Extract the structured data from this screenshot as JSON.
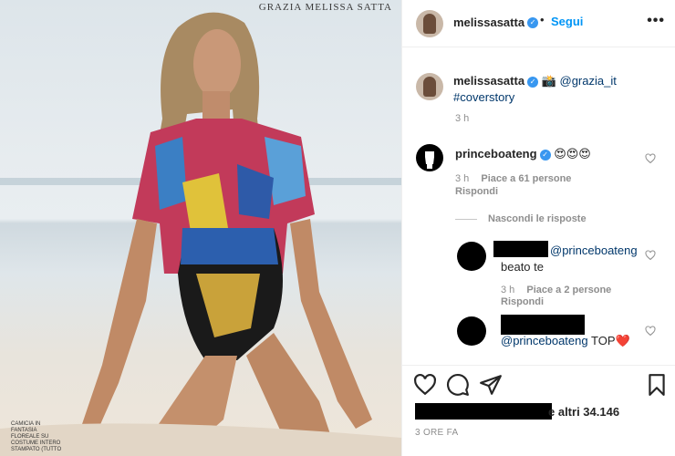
{
  "photo": {
    "magazine_title": "GRAZIA MELISSA SATTA",
    "caption": "CAMICIA IN FANTASIA FLOREALE SU COSTUME INTERO STAMPATO (TUTTO"
  },
  "header": {
    "username": "melissasatta",
    "separator": "•",
    "follow_label": "Segui",
    "more_label": "•••"
  },
  "caption_block": {
    "username": "melissasatta",
    "camera_emoji": "📸",
    "mention": "@grazia_it",
    "hashtag": "#coverstory",
    "time": "3 h"
  },
  "comments": [
    {
      "username": "princeboateng",
      "text": "😍😍😍",
      "time": "3 h",
      "likes": "Piace a 61 persone",
      "reply_label": "Rispondi",
      "hide_replies": "Nascondi le risposte"
    },
    {
      "mention": "@princeboateng",
      "text": "beato te",
      "time": "3 h",
      "likes": "Piace a 2 persone",
      "reply_label": "Rispondi"
    },
    {
      "mention": "@princeboateng",
      "text": "TOP❤️"
    }
  ],
  "footer": {
    "likes_text": "e altri 34.146",
    "timestamp": "3 ORE FA"
  },
  "icons": {
    "verified": "verified-badge-icon",
    "heart": "heart-icon",
    "comment": "comment-icon",
    "share": "share-icon",
    "save": "bookmark-icon"
  },
  "colors": {
    "link": "#00376b",
    "follow": "#0095f6",
    "verified": "#3897f0",
    "meta": "#8e8e8e",
    "heart_red": "#ed4956"
  }
}
